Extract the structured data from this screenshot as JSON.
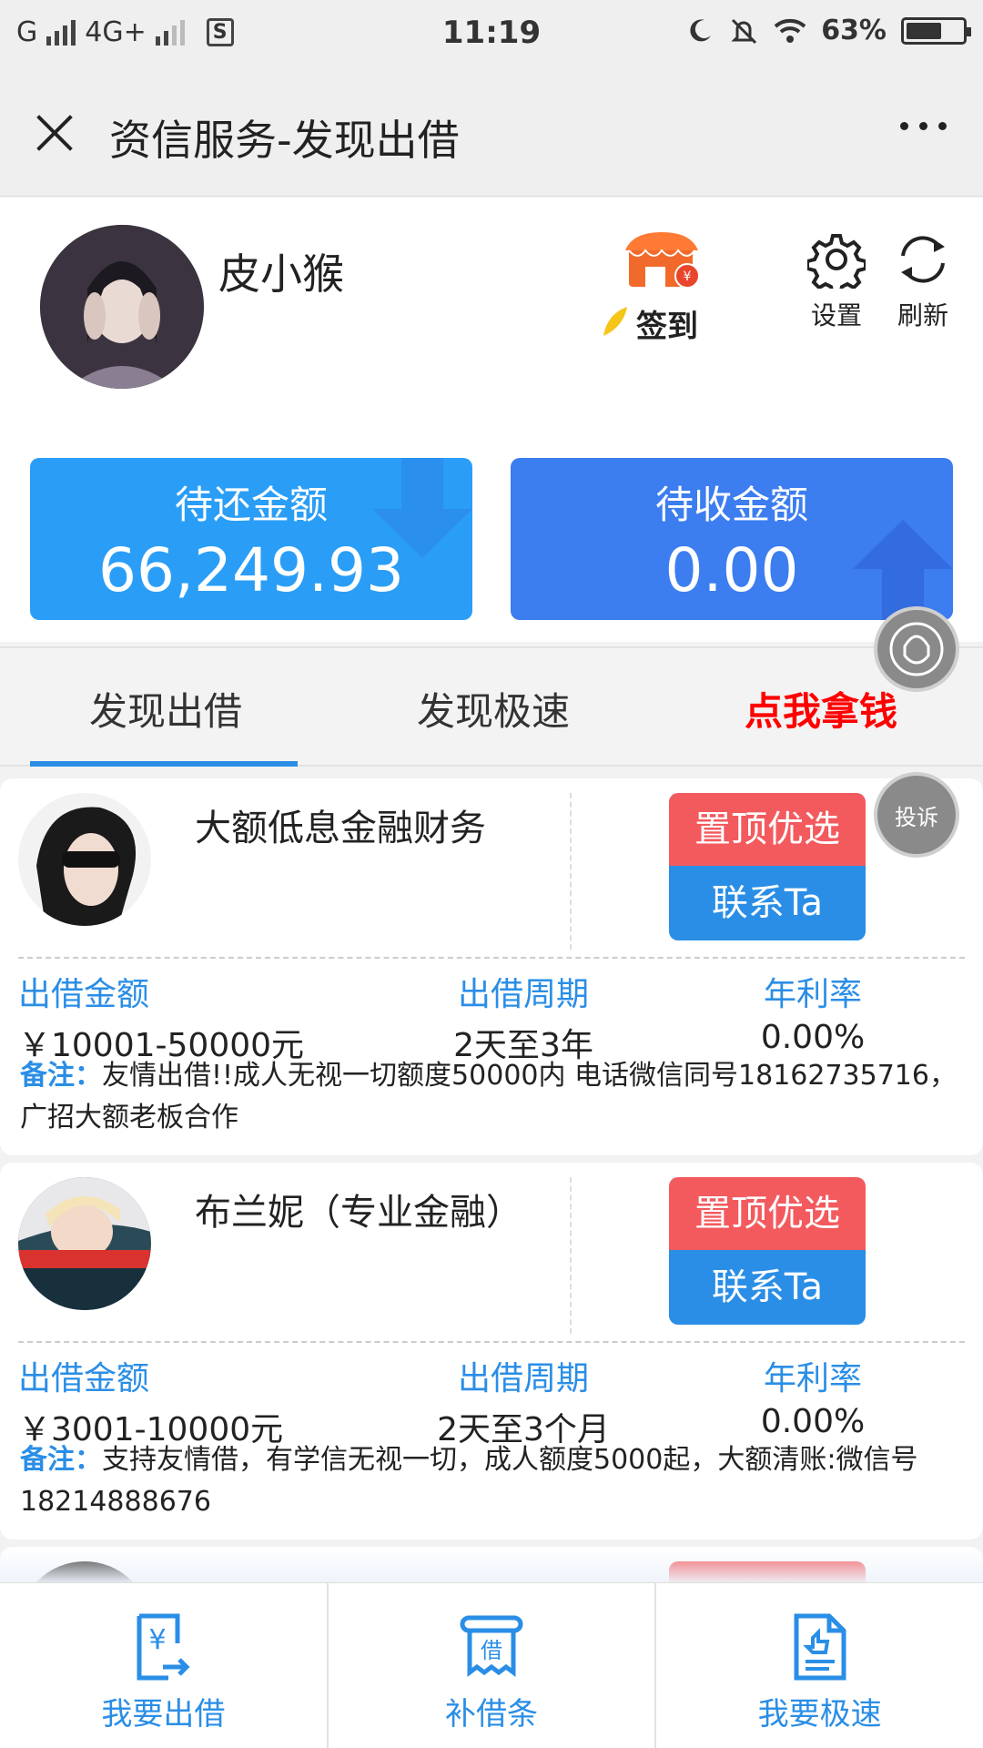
{
  "status_bar": {
    "carrier1": "G",
    "network": "4G+",
    "sim_icon": "S",
    "time": "11:19",
    "battery": "63%",
    "battery_level": 0.63,
    "icons": [
      "signal-icon",
      "moon-icon",
      "mute-icon",
      "wifi-icon",
      "battery-icon"
    ]
  },
  "header": {
    "title": "资信服务-发现出借"
  },
  "profile": {
    "name": "皮小猴",
    "checkin_label": "签到",
    "settings_label": "设置",
    "refresh_label": "刷新"
  },
  "amounts": {
    "repay_label": "待还金额",
    "repay_value": "66,249.93",
    "receive_label": "待收金额",
    "receive_value": "0.00"
  },
  "tabs": [
    {
      "label": "发现出借",
      "active": true
    },
    {
      "label": "发现极速",
      "active": false
    },
    {
      "label": "点我拿钱",
      "active": false,
      "color": "#ff0000"
    }
  ],
  "floating": {
    "complain_label": "投诉"
  },
  "listings": [
    {
      "name": "大额低息金融财务",
      "top_label": "置顶优选",
      "contact_label": "联系Ta",
      "amount_label": "出借金额",
      "amount_value": "￥10001-50000元",
      "period_label": "出借周期",
      "period_value": "2天至3年",
      "rate_label": "年利率",
      "rate_value": "0.00%",
      "note_label": "备注：",
      "note_text": "友情出借!!成人无视一切额度50000内 电话微信同号18162735716，广招大额老板合作"
    },
    {
      "name": "布兰妮（专业金融）",
      "top_label": "置顶优选",
      "contact_label": "联系Ta",
      "amount_label": "出借金额",
      "amount_value": "￥3001-10000元",
      "period_label": "出借周期",
      "period_value": "2天至3个月",
      "rate_label": "年利率",
      "rate_value": "0.00%",
      "note_label": "备注：",
      "note_text": "支持友情借，有学信无视一切，成人额度5000起，大额清账:微信号18214888676"
    }
  ],
  "bottom_nav": [
    {
      "label": "我要出借",
      "icon": "lend-icon"
    },
    {
      "label": "补借条",
      "icon": "iou-icon"
    },
    {
      "label": "我要极速",
      "icon": "fast-icon"
    }
  ],
  "colors": {
    "accent": "#2a8ee6",
    "repay_card": "#2a9ef6",
    "receive_card": "#3c7df0",
    "top_button": "#f35a5e",
    "promo_tab": "#ff0000"
  }
}
